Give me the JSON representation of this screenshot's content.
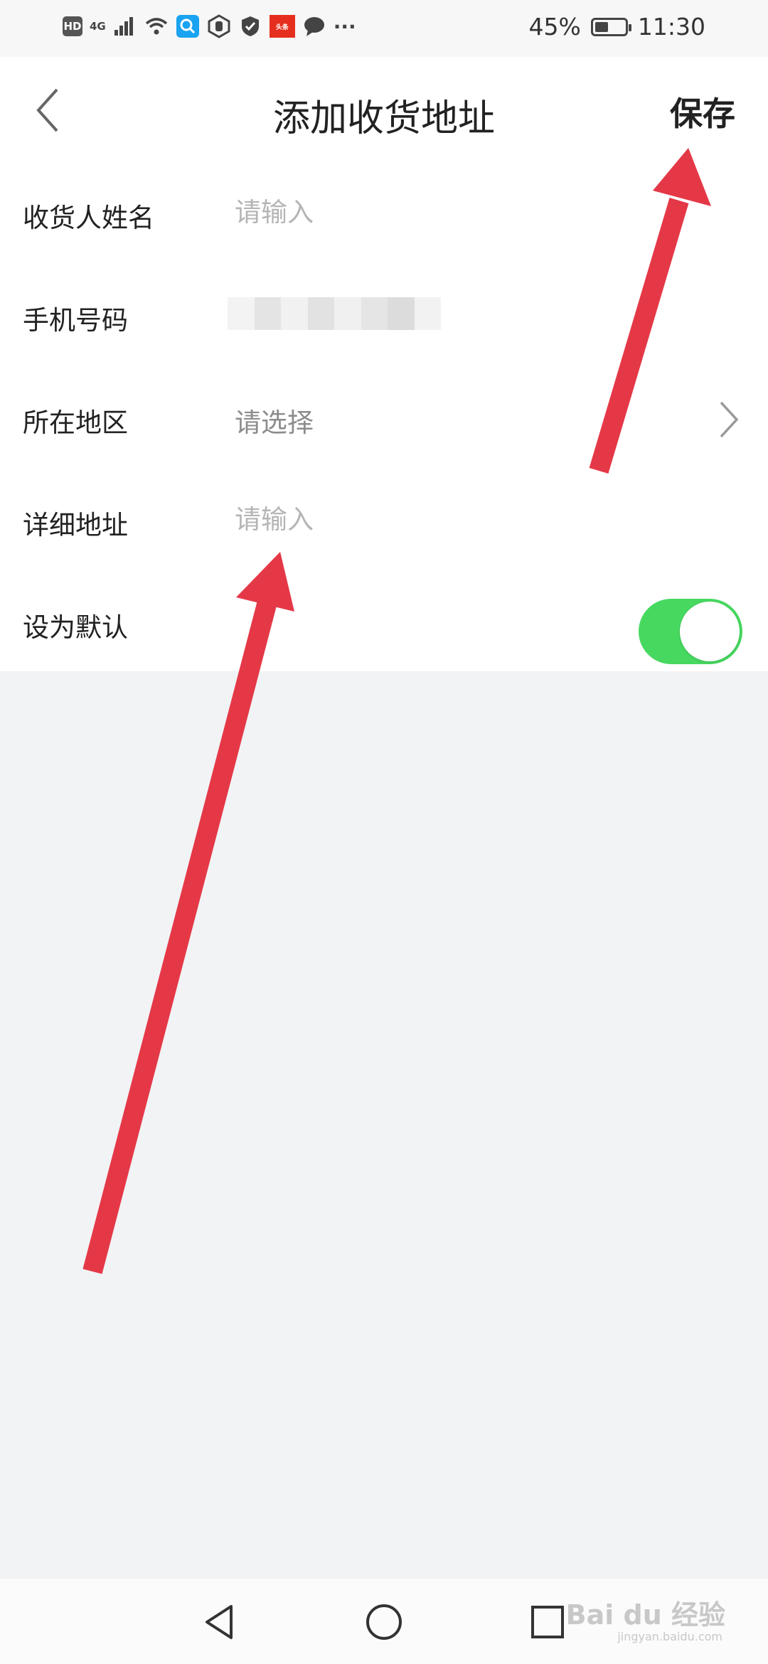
{
  "status_bar": {
    "hd": "HD",
    "network": "4G",
    "more": "···",
    "news_label": "头条",
    "battery_text": "45%",
    "battery_level": 0.45,
    "time": "11:30",
    "icons": [
      "signal-icon",
      "wifi-icon",
      "search-app-icon",
      "hand-icon",
      "shield-icon",
      "news-app-icon",
      "chat-bubble-icon"
    ]
  },
  "header": {
    "title": "添加收货地址",
    "save_label": "保存",
    "back_icon": "chevron-left-icon"
  },
  "form": {
    "rows": [
      {
        "label": "收货人姓名",
        "placeholder": "请输入",
        "value": ""
      },
      {
        "label": "手机号码",
        "value": "已打码"
      },
      {
        "label": "所在地区",
        "placeholder": "请选择",
        "value": ""
      },
      {
        "label": "详细地址",
        "placeholder": "请输入",
        "value": ""
      },
      {
        "label": "设为默认",
        "toggle_on": true
      }
    ]
  },
  "colors": {
    "toggle_on": "#47d860",
    "arrow": "#e53847",
    "placeholder": "#b5b5b5",
    "background": "#f2f3f5"
  },
  "nav_bar": {
    "icons": [
      "back-triangle-icon",
      "home-circle-icon",
      "recents-square-icon"
    ],
    "watermark": "Bai du 经验",
    "watermark_sub": "jingyan.baidu.com"
  }
}
